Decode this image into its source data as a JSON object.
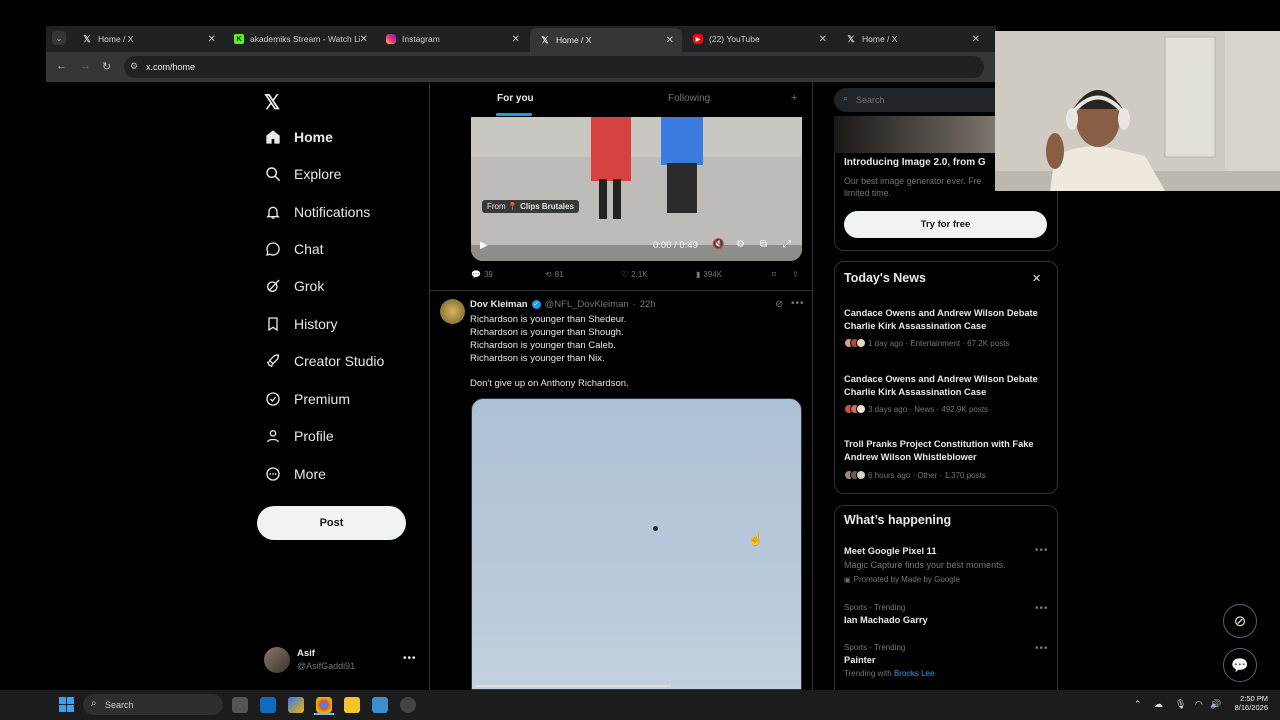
{
  "browser": {
    "tabs": [
      {
        "title": "Home / X",
        "icon": "x-logo-icon"
      },
      {
        "title": "akademiks Stream - Watch Live",
        "icon": "kick-icon"
      },
      {
        "title": "Instagram",
        "icon": "instagram-icon"
      },
      {
        "title": "Home / X",
        "icon": "x-logo-icon",
        "active": true
      },
      {
        "title": "(22) YouTube",
        "icon": "youtube-icon"
      },
      {
        "title": "Home / X",
        "icon": "x-logo-icon"
      }
    ],
    "url": "x.com/home"
  },
  "sidebar": {
    "items": [
      {
        "label": "Home",
        "icon": "home-icon"
      },
      {
        "label": "Explore",
        "icon": "search-icon"
      },
      {
        "label": "Notifications",
        "icon": "bell-icon"
      },
      {
        "label": "Chat",
        "icon": "chat-bubble-icon"
      },
      {
        "label": "Grok",
        "icon": "grok-icon"
      },
      {
        "label": "History",
        "icon": "bookmark-icon"
      },
      {
        "label": "Creator Studio",
        "icon": "rocket-icon"
      },
      {
        "label": "Premium",
        "icon": "verified-badge-icon"
      },
      {
        "label": "Profile",
        "icon": "person-icon"
      },
      {
        "label": "More",
        "icon": "more-circle-icon"
      }
    ],
    "post_label": "Post",
    "account": {
      "name": "Asif",
      "handle": "@AsifGaddi91"
    }
  },
  "feed": {
    "tabs": [
      "For you",
      "Following"
    ],
    "video": {
      "source_prefix": "From",
      "source_name": "Clips Brutales",
      "time": "0:00 / 0:49"
    },
    "actions": {
      "replies": "39",
      "reposts": "81",
      "likes": "2.1K",
      "views": "394K"
    },
    "tweet": {
      "author": "Dov Kleiman",
      "handle": "@NFL_DovKleiman",
      "age": "22h",
      "lines": [
        "Richardson is younger than Shedeur.",
        "Richardson is younger than Shough.",
        "Richardson is younger than Caleb.",
        "Richardson is younger than Nix."
      ],
      "closing": "Don't give up on Anthony Richardson."
    }
  },
  "right": {
    "search_placeholder": "Search",
    "promo": {
      "title": "Introducing Image 2.0, from G",
      "body_line1": "Our best image generator ever. Fre",
      "body_line2": "limited time.",
      "button": "Try for free"
    },
    "news": {
      "title": "Today's News",
      "items": [
        {
          "title": "Candace Owens and Andrew Wilson Debate Charlie Kirk Assassination Case",
          "meta": "1 day ago · Entertainment · 67.2K posts"
        },
        {
          "title": "Candace Owens and Andrew Wilson Debate Charlie Kirk Assassination Case",
          "meta": "3 days ago · News · 492.9K posts"
        },
        {
          "title": "Troll Pranks Project Constitution with Fake Andrew Wilson Whistleblower",
          "meta": "6 hours ago · Other · 1,370 posts"
        }
      ]
    },
    "happening": {
      "title": "What’s happening",
      "items": [
        {
          "title": "Meet Google Pixel 11",
          "desc": "Magic Capture finds your best moments.",
          "meta": "Promoted by Made by Google"
        },
        {
          "category": "Sports · Trending",
          "title": "Ian Machado Garry"
        },
        {
          "category": "Sports · Trending",
          "title": "Painter",
          "trending_prefix": "Trending with",
          "trending_with": "Brooks Lee"
        }
      ]
    }
  },
  "taskbar": {
    "search_label": "Search",
    "time": "2:50 PM",
    "date": "8/16/2026"
  }
}
